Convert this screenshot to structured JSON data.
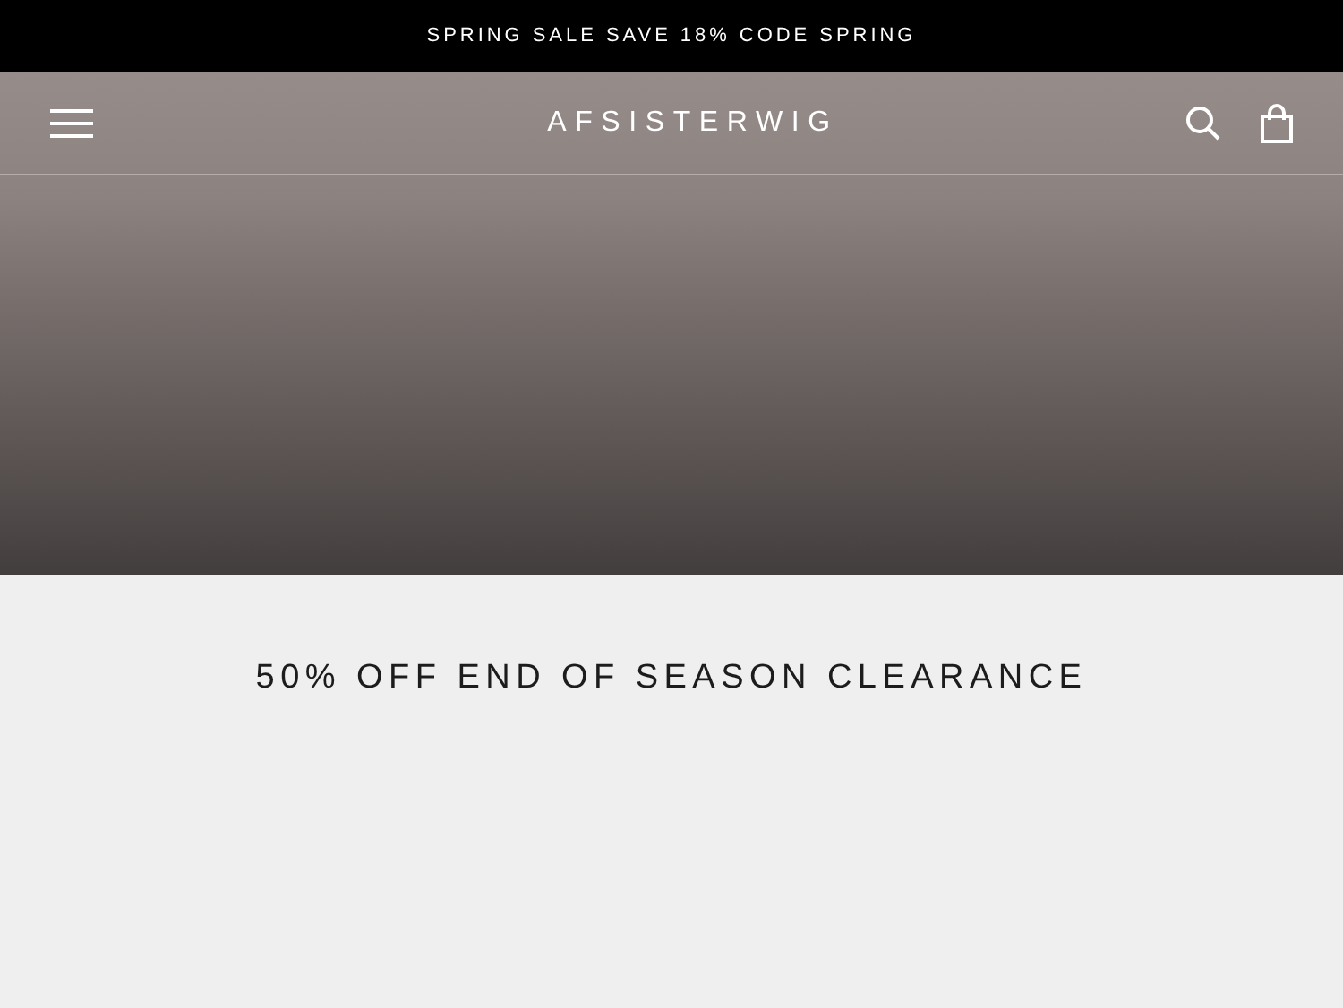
{
  "announcement": "SPRING SALE SAVE 18% CODE SPRING",
  "header": {
    "logo": "AFSISTERWIG"
  },
  "section": {
    "title": "50% OFF END OF SEASON CLEARANCE"
  }
}
